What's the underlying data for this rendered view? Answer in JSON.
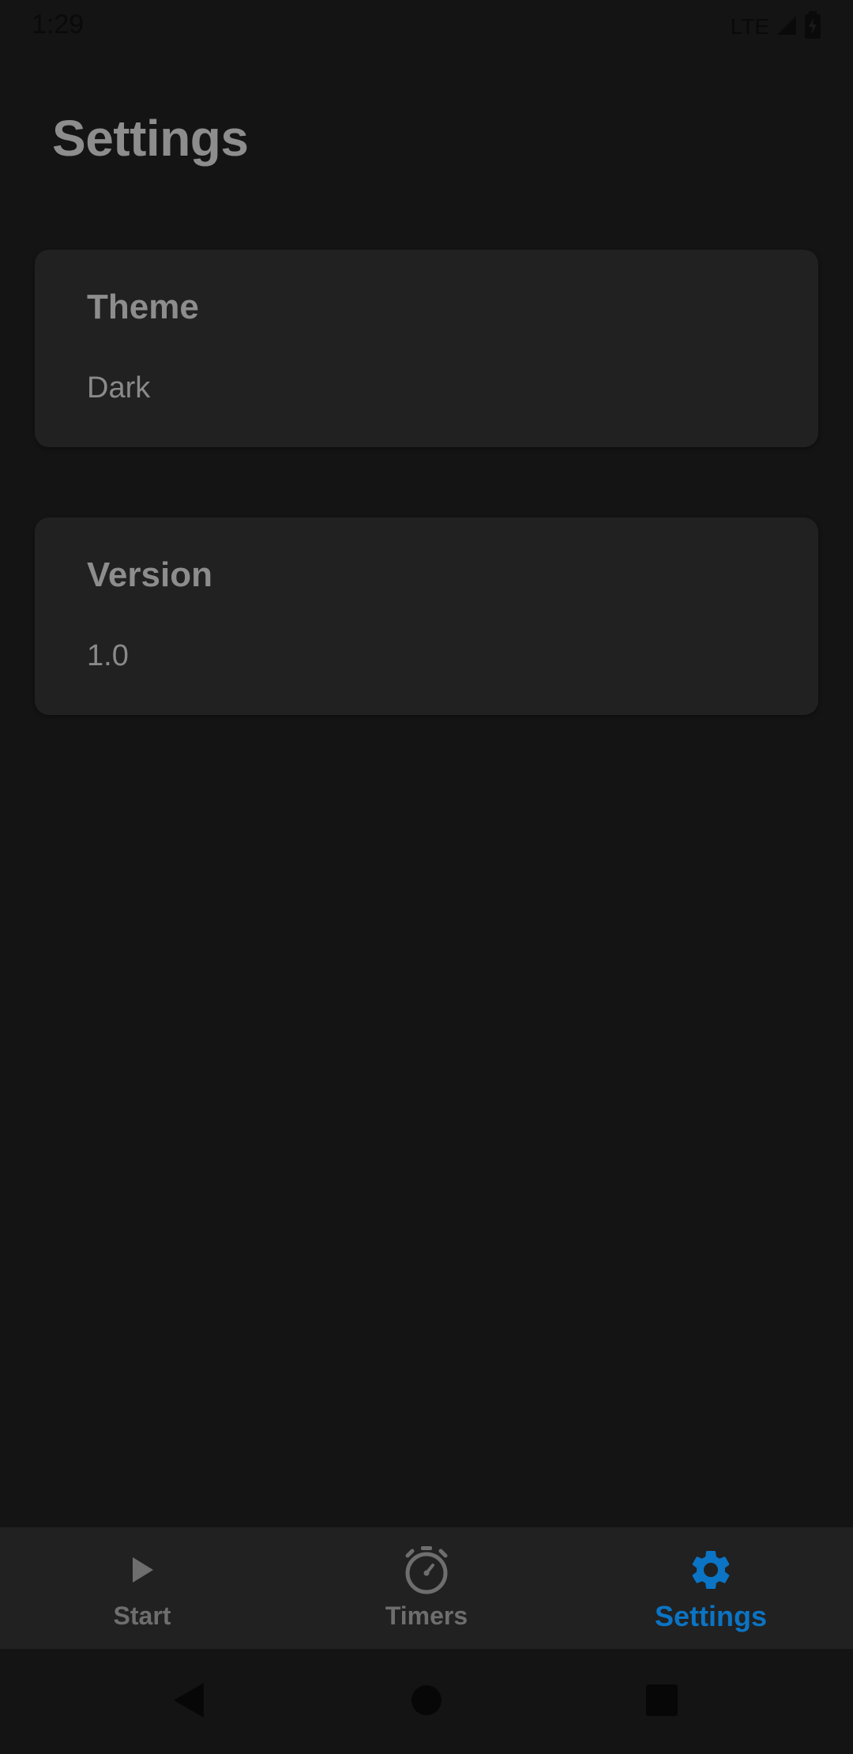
{
  "status_bar": {
    "time": "1:29",
    "network": "LTE"
  },
  "header": {
    "title": "Settings"
  },
  "cards": [
    {
      "title": "Theme",
      "value": "Dark"
    },
    {
      "title": "Version",
      "value": "1.0"
    }
  ],
  "bottom_nav": {
    "items": [
      {
        "label": "Start",
        "icon": "play-icon",
        "active": false
      },
      {
        "label": "Timers",
        "icon": "stopwatch-icon",
        "active": false
      },
      {
        "label": "Settings",
        "icon": "gear-icon",
        "active": true
      }
    ],
    "active_color": "#0b74c4",
    "inactive_color": "#6e6e6e"
  },
  "system_nav": {
    "back": "back-icon",
    "home": "home-icon",
    "recents": "recents-icon"
  }
}
